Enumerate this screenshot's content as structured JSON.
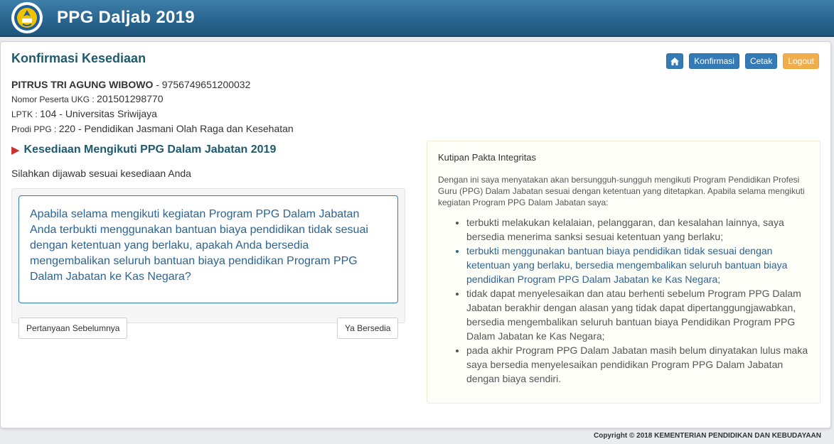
{
  "header": {
    "app_title": "PPG Daljab 2019",
    "logo": "tut-wuri-handayani-logo"
  },
  "page": {
    "title": "Konfirmasi Kesediaan",
    "toolbar": {
      "home": "home-icon",
      "konfirmasi": "Konfirmasi",
      "cetak": "Cetak",
      "logout": "Logout"
    }
  },
  "participant": {
    "name": "PITRUS TRI AGUNG WIBOWO",
    "id_suffix": " - 9756749651200032",
    "ukg_label": "Nomor Peserta UKG : ",
    "ukg_value": "201501298770",
    "lptk_label": "LPTK : ",
    "lptk_value": "104 - Universitas Sriwijaya",
    "prodi_label": "Prodi PPG : ",
    "prodi_value": "220 - Pendidikan Jasmani Olah Raga dan Kesehatan"
  },
  "section": {
    "title": "Kesediaan Mengikuti PPG Dalam Jabatan 2019",
    "prompt": "Silahkan dijawab sesuai kesediaan Anda",
    "question": "Apabila selama mengikuti kegiatan Program PPG Dalam Jabatan Anda terbukti menggunakan bantuan biaya pendidikan tidak sesuai dengan ketentuan yang berlaku, apakah Anda bersedia mengembalikan seluruh bantuan biaya pendidikan Program PPG Dalam Jabatan ke Kas Negara?",
    "prev_button": "Pertanyaan Sebelumnya",
    "yes_button": "Ya Bersedia"
  },
  "pakta": {
    "title": "Kutipan Pakta Integritas",
    "intro": "Dengan ini saya menyatakan akan bersungguh-sungguh mengikuti Program Pendidikan Profesi Guru (PPG) Dalam Jabatan sesuai dengan ketentuan yang ditetapkan. Apabila selama mengikuti kegiatan Program PPG Dalam Jabatan saya:",
    "items": [
      "terbukti melakukan kelalaian, pelanggaran, dan kesalahan lainnya, saya bersedia menerima sanksi sesuai ketentuan yang berlaku;",
      "terbukti menggunakan bantuan biaya pendidikan tidak sesuai dengan ketentuan yang berlaku, bersedia mengembalikan seluruh bantuan biaya pendidikan Program PPG Dalam Jabatan ke Kas Negara;",
      "tidak dapat menyelesaikan dan atau berhenti sebelum Program PPG Dalam Jabatan berakhir dengan alasan yang tidak dapat dipertanggungjawabkan, bersedia mengembalikan seluruh bantuan biaya Pendidikan Program PPG Dalam Jabatan ke Kas Negara;",
      "pada akhir Program PPG Dalam Jabatan masih belum dinyatakan lulus maka saya bersedia menyelesaikan pendidikan Program PPG Dalam Jabatan dengan biaya sendiri."
    ]
  },
  "footer": {
    "copyright": "Copyright © 2018 KEMENTERIAN PENDIDIKAN DAN KEBUDAYAAN"
  },
  "colors": {
    "header": "#2a6690",
    "primary": "#337ab7",
    "warning": "#f0ad4e",
    "heading": "#1e5a6f"
  }
}
